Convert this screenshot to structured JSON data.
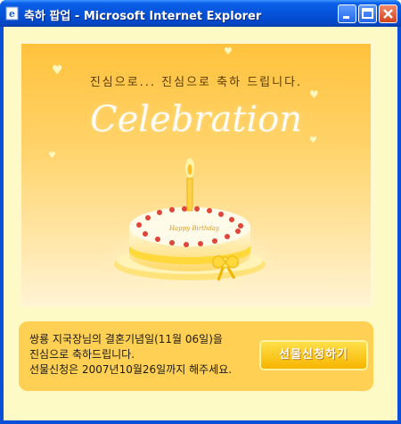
{
  "window": {
    "title": "축하 팝업 - Microsoft Internet Explorer",
    "icon": "ie-icon",
    "controls": [
      "minimize-icon",
      "maximize-icon",
      "close-icon"
    ]
  },
  "card": {
    "message": "진심으로... 진심으로 축하 드립니다.",
    "celebration": "Celebration",
    "cake_text": "Happy Birthday"
  },
  "notice": {
    "line1": "쌍룡 지국장님의 결혼기념일(11월 06일)을",
    "line2": "진심으로 축하드립니다.",
    "line3": "선물신청은 2007년10월26일까지 해주세요."
  },
  "gift_button": "선물신청하기"
}
